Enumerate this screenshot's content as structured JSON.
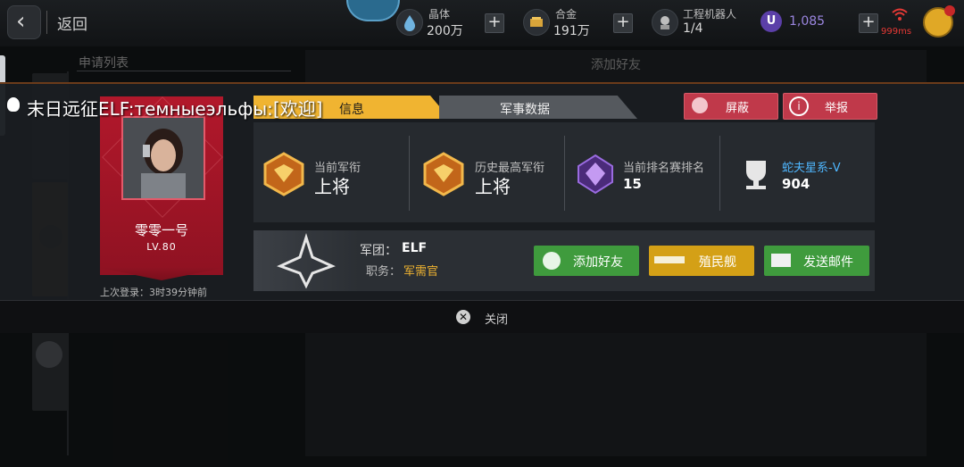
{
  "header": {
    "back_label": "返回",
    "resources": [
      {
        "icon": "crystal-icon",
        "label": "晶体",
        "value": "200万"
      },
      {
        "icon": "alloy-icon",
        "label": "合金",
        "value": "191万"
      },
      {
        "icon": "robot-icon",
        "label": "工程机器人",
        "value": "1/4"
      }
    ],
    "currency_value": "1,085",
    "ping": "999ms"
  },
  "side": {
    "apply_list_title": "申请列表"
  },
  "background": {
    "add_friend_title": "添加好友"
  },
  "chat": {
    "message": "末日远征ELF:темныеэльфы:[欢迎]"
  },
  "profile": {
    "name": "零零一号",
    "level": "LV.80",
    "last_login": "上次登录：3时39分钟前"
  },
  "tabs": {
    "info": "信息",
    "military": "军事数据"
  },
  "buttons": {
    "block": "屏蔽",
    "report": "举报",
    "add_friend": "添加好友",
    "colony_ship": "殖民舰",
    "send_mail": "发送邮件",
    "close": "关闭"
  },
  "stats": [
    {
      "label": "当前军衔",
      "value": "上将"
    },
    {
      "label": "历史最高军衔",
      "value": "上将"
    },
    {
      "label": "当前排名赛排名",
      "value": "15"
    },
    {
      "label": "蛇夫星系-V",
      "value": "904"
    }
  ],
  "legion": {
    "label": "军团：",
    "name": "ELF",
    "role_label": "职务：",
    "role": "军需官"
  },
  "colors": {
    "tab_active": "#f0b431",
    "red_button": "#c0394a",
    "green_button": "#3f9b3d",
    "gold_button": "#d4a016",
    "link_blue": "#4fb7ff",
    "role_gold": "#f0b431"
  }
}
